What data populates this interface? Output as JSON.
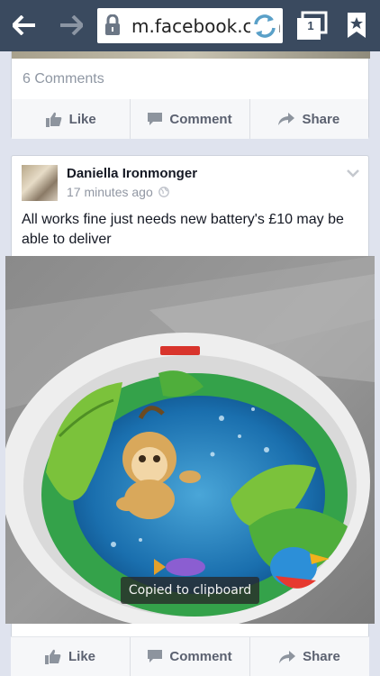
{
  "browser": {
    "url": "m.facebook.com",
    "tab_count": "1"
  },
  "previous_post": {
    "comments": "6 Comments",
    "actions": {
      "like": "Like",
      "comment": "Comment",
      "share": "Share"
    }
  },
  "post": {
    "author": "Daniella Ironmonger",
    "time": "17 minutes ago",
    "text": "All works fine just needs new battery's £10 may be able to deliver",
    "actions": {
      "like": "Like",
      "comment": "Comment",
      "share": "Share"
    }
  },
  "toast": "Copied to clipboard",
  "colors": {
    "browser_bar": "#3a4a5f",
    "background": "#dfe3ee",
    "action_text": "#5b6170"
  }
}
